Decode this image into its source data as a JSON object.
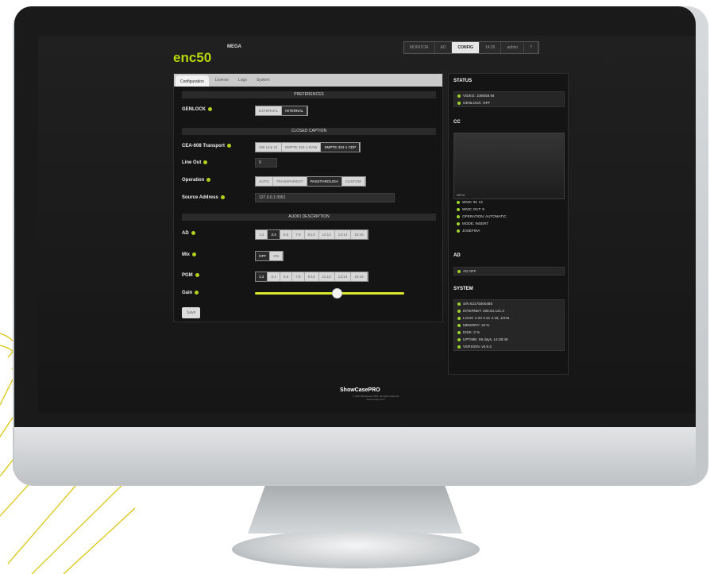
{
  "app": {
    "logo": "enc50",
    "device": "MEGA"
  },
  "topnav": [
    "MONITOR",
    "AD",
    "CONFIG",
    "14:35",
    "admin",
    "?"
  ],
  "tabs": [
    "Configuration",
    "License",
    "Logs",
    "System"
  ],
  "preferences": {
    "title": "PREFERENCES",
    "genlock_label": "GENLOCK",
    "genlock_options": [
      "EXTERNAL",
      "INTERNAL"
    ],
    "genlock_selected": "INTERNAL"
  },
  "closed_caption": {
    "title": "CLOSED CAPTION",
    "transport_label": "CEA-608 Transport",
    "transport_options": [
      "VBI Line 21",
      "SMPTE 334-1 RAW",
      "SMPTE 334-1 CDP"
    ],
    "transport_selected": "SMPTE 334-1 CDP",
    "lineout_label": "Line Out",
    "lineout_value": "9",
    "operation_label": "Operation",
    "operation_options": [
      "AUTO",
      "TRANSPARENT",
      "PASSTHROUGH",
      "CUSTOM"
    ],
    "operation_selected": "PASSTHROUGH",
    "source_label": "Source Address",
    "source_value": "127.0.0.1:3001"
  },
  "audio_description": {
    "title": "AUDIO DESCRIPTION",
    "ad_label": "AD",
    "ad_options": [
      "1:2",
      "3:4",
      "5:6",
      "7:8",
      "9:10",
      "11:12",
      "13:14",
      "15:16"
    ],
    "ad_selected": "3:4",
    "mix_label": "Mix",
    "mix_options": [
      "OFF",
      "ON"
    ],
    "mix_selected": "OFF",
    "pgm_label": "PGM",
    "pgm_options": [
      "1:2",
      "3:4",
      "5:6",
      "7:8",
      "9:10",
      "11:12",
      "13:14",
      "15:16"
    ],
    "pgm_selected": "1:2",
    "gain_label": "Gain",
    "gain_value": 0.55
  },
  "save_label": "Save",
  "status": {
    "title": "STATUS",
    "lines": [
      "VIDEO: 1080i59.94",
      "GENLOCK: OFF"
    ]
  },
  "cc": {
    "title": "CC",
    "caption_label": "MEGA",
    "lines": [
      "WNIC IN: 13",
      "WNIC OUT: 9",
      "OPERATION: AUTOMATIC",
      "MODE: INSERT",
      "JOSEFINA"
    ]
  },
  "ad": {
    "title": "AD",
    "lines": [
      "AD OFF"
    ]
  },
  "system": {
    "title": "SYSTEM",
    "lines": [
      "S/N 62175000485",
      "INTERNET: 208.54.121.3",
      "LOAD: 2.22 2.21 2.18, 1/244",
      "MEMORY: 16 %",
      "DISK: 3 %",
      "UPTIME: 59 days, 14:38:49",
      "VERSION: v0.8.4"
    ]
  },
  "footer": {
    "brand": "ShowCasePRO",
    "line1": "© 2023 ShowCase PRO. All rights reserved",
    "line2": "www.mega-pro.tv"
  },
  "colors": {
    "accent": "#b8d80a",
    "status_dot": "#9ed32d"
  }
}
